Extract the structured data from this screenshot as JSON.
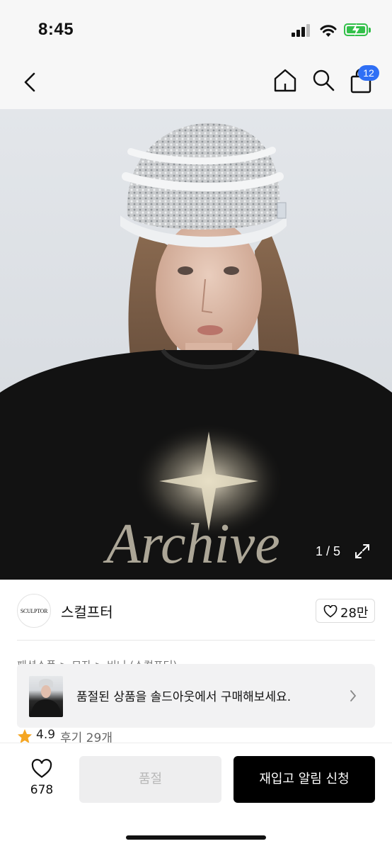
{
  "status_bar": {
    "time": "8:45"
  },
  "nav": {
    "cart_count": "12"
  },
  "hero": {
    "counter": "1 / 5",
    "shirt_print": "Archive"
  },
  "seller": {
    "name": "스컬프터",
    "logo_text": "SCULPTOR",
    "likes": "28만"
  },
  "breadcrumb": "패션소품 > 모자 > 비니 (스컬프터)",
  "banner": {
    "text": "품절된 상품을 솔드아웃에서 구매해보세요."
  },
  "rating": {
    "score": "4.9",
    "reviews": "후기 29개"
  },
  "bottom_bar": {
    "wish_count": "678",
    "soldout_label": "품절",
    "notify_label": "재입고 알림 신청"
  },
  "colors": {
    "badge": "#2f6ff5",
    "battery": "#33c04a",
    "star": "#f5a623",
    "cta": "#000000"
  }
}
